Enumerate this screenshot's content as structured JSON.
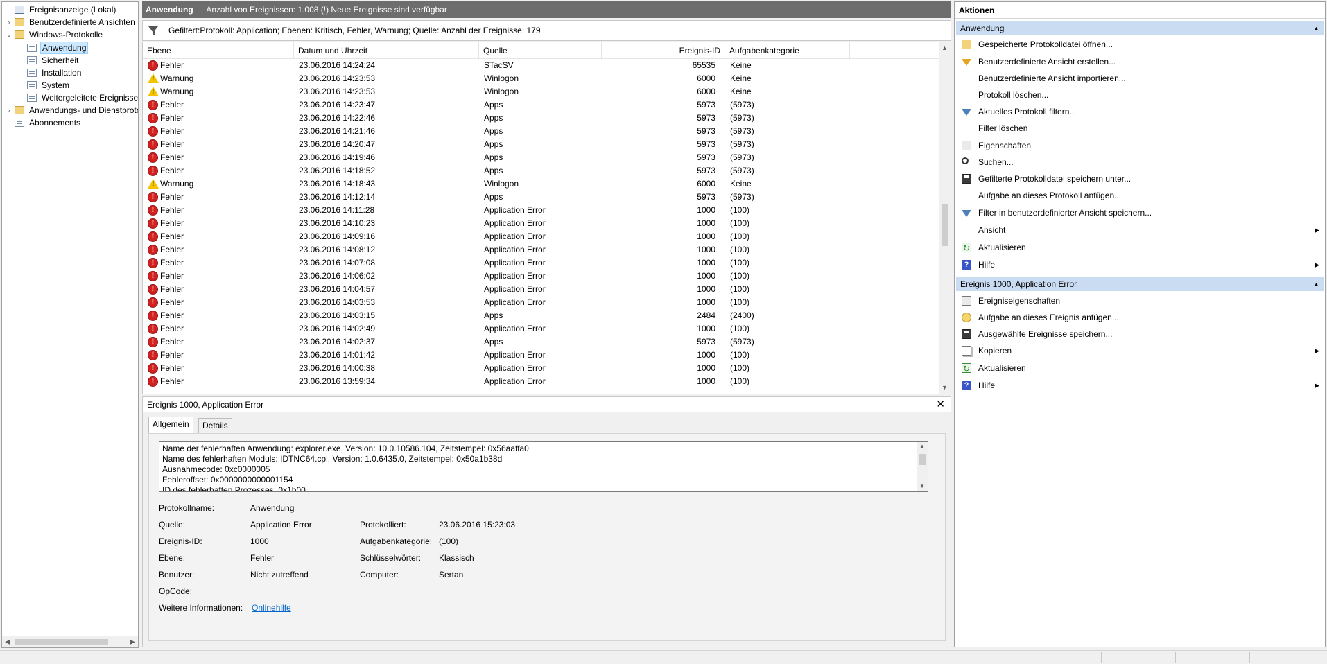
{
  "tree": {
    "items": [
      {
        "label": "Ereignisanzeige (Lokal)",
        "expander": "",
        "icon": "computer-icon"
      },
      {
        "label": "Benutzerdefinierte Ansichten",
        "expander": "›",
        "icon": "folder-icon"
      },
      {
        "label": "Windows-Protokolle",
        "expander": "⌄",
        "icon": "folder-icon"
      },
      {
        "label": "Anwendung",
        "expander": "",
        "icon": "log-icon"
      },
      {
        "label": "Sicherheit",
        "expander": "",
        "icon": "log-icon"
      },
      {
        "label": "Installation",
        "expander": "",
        "icon": "log-icon"
      },
      {
        "label": "System",
        "expander": "",
        "icon": "log-icon"
      },
      {
        "label": "Weitergeleitete Ereignisse",
        "expander": "",
        "icon": "log-icon"
      },
      {
        "label": "Anwendungs- und Dienstprotokolle",
        "expander": "›",
        "icon": "folder-icon"
      },
      {
        "label": "Abonnements",
        "expander": "",
        "icon": "subscription-icon"
      }
    ]
  },
  "header": {
    "title": "Anwendung",
    "info": "Anzahl von Ereignissen: 1.008 (!) Neue Ereignisse sind verfügbar"
  },
  "filter": {
    "text": "Gefiltert:Protokoll: Application; Ebenen: Kritisch, Fehler, Warnung; Quelle:  Anzahl der Ereignisse: 179"
  },
  "grid": {
    "columns": [
      "Ebene",
      "Datum und Uhrzeit",
      "Quelle",
      "Ereignis-ID",
      "Aufgabenkategorie"
    ],
    "rows": [
      {
        "level": "Fehler",
        "type": "error",
        "date": "23.06.2016 14:24:24",
        "source": "STacSV",
        "id": "65535",
        "cat": "Keine"
      },
      {
        "level": "Warnung",
        "type": "warning",
        "date": "23.06.2016 14:23:53",
        "source": "Winlogon",
        "id": "6000",
        "cat": "Keine"
      },
      {
        "level": "Warnung",
        "type": "warning",
        "date": "23.06.2016 14:23:53",
        "source": "Winlogon",
        "id": "6000",
        "cat": "Keine"
      },
      {
        "level": "Fehler",
        "type": "error",
        "date": "23.06.2016 14:23:47",
        "source": "Apps",
        "id": "5973",
        "cat": "(5973)"
      },
      {
        "level": "Fehler",
        "type": "error",
        "date": "23.06.2016 14:22:46",
        "source": "Apps",
        "id": "5973",
        "cat": "(5973)"
      },
      {
        "level": "Fehler",
        "type": "error",
        "date": "23.06.2016 14:21:46",
        "source": "Apps",
        "id": "5973",
        "cat": "(5973)"
      },
      {
        "level": "Fehler",
        "type": "error",
        "date": "23.06.2016 14:20:47",
        "source": "Apps",
        "id": "5973",
        "cat": "(5973)"
      },
      {
        "level": "Fehler",
        "type": "error",
        "date": "23.06.2016 14:19:46",
        "source": "Apps",
        "id": "5973",
        "cat": "(5973)"
      },
      {
        "level": "Fehler",
        "type": "error",
        "date": "23.06.2016 14:18:52",
        "source": "Apps",
        "id": "5973",
        "cat": "(5973)"
      },
      {
        "level": "Warnung",
        "type": "warning",
        "date": "23.06.2016 14:18:43",
        "source": "Winlogon",
        "id": "6000",
        "cat": "Keine"
      },
      {
        "level": "Fehler",
        "type": "error",
        "date": "23.06.2016 14:12:14",
        "source": "Apps",
        "id": "5973",
        "cat": "(5973)"
      },
      {
        "level": "Fehler",
        "type": "error",
        "date": "23.06.2016 14:11:28",
        "source": "Application Error",
        "id": "1000",
        "cat": "(100)"
      },
      {
        "level": "Fehler",
        "type": "error",
        "date": "23.06.2016 14:10:23",
        "source": "Application Error",
        "id": "1000",
        "cat": "(100)"
      },
      {
        "level": "Fehler",
        "type": "error",
        "date": "23.06.2016 14:09:16",
        "source": "Application Error",
        "id": "1000",
        "cat": "(100)"
      },
      {
        "level": "Fehler",
        "type": "error",
        "date": "23.06.2016 14:08:12",
        "source": "Application Error",
        "id": "1000",
        "cat": "(100)"
      },
      {
        "level": "Fehler",
        "type": "error",
        "date": "23.06.2016 14:07:08",
        "source": "Application Error",
        "id": "1000",
        "cat": "(100)"
      },
      {
        "level": "Fehler",
        "type": "error",
        "date": "23.06.2016 14:06:02",
        "source": "Application Error",
        "id": "1000",
        "cat": "(100)"
      },
      {
        "level": "Fehler",
        "type": "error",
        "date": "23.06.2016 14:04:57",
        "source": "Application Error",
        "id": "1000",
        "cat": "(100)"
      },
      {
        "level": "Fehler",
        "type": "error",
        "date": "23.06.2016 14:03:53",
        "source": "Application Error",
        "id": "1000",
        "cat": "(100)"
      },
      {
        "level": "Fehler",
        "type": "error",
        "date": "23.06.2016 14:03:15",
        "source": "Apps",
        "id": "2484",
        "cat": "(2400)"
      },
      {
        "level": "Fehler",
        "type": "error",
        "date": "23.06.2016 14:02:49",
        "source": "Application Error",
        "id": "1000",
        "cat": "(100)"
      },
      {
        "level": "Fehler",
        "type": "error",
        "date": "23.06.2016 14:02:37",
        "source": "Apps",
        "id": "5973",
        "cat": "(5973)"
      },
      {
        "level": "Fehler",
        "type": "error",
        "date": "23.06.2016 14:01:42",
        "source": "Application Error",
        "id": "1000",
        "cat": "(100)"
      },
      {
        "level": "Fehler",
        "type": "error",
        "date": "23.06.2016 14:00:38",
        "source": "Application Error",
        "id": "1000",
        "cat": "(100)"
      },
      {
        "level": "Fehler",
        "type": "error",
        "date": "23.06.2016 13:59:34",
        "source": "Application Error",
        "id": "1000",
        "cat": "(100)"
      }
    ]
  },
  "detail": {
    "title": "Ereignis 1000, Application Error",
    "tabs": [
      "Allgemein",
      "Details"
    ],
    "description": [
      "Name der fehlerhaften Anwendung: explorer.exe, Version: 10.0.10586.104, Zeitstempel: 0x56aaffa0",
      "Name des fehlerhaften Moduls: IDTNC64.cpl, Version: 1.0.6435.0, Zeitstempel: 0x50a1b38d",
      "Ausnahmecode: 0xc0000005",
      "Fehleroffset: 0x0000000000001154",
      "ID des fehlerhaften Prozesses: 0x1b00"
    ],
    "fields": {
      "protokollname_label": "Protokollname:",
      "protokollname": "Anwendung",
      "quelle_label": "Quelle:",
      "quelle": "Application Error",
      "protokolliert_label": "Protokolliert:",
      "protokolliert": "23.06.2016 15:23:03",
      "id_label": "Ereignis-ID:",
      "id": "1000",
      "kategorie_label": "Aufgabenkategorie:",
      "kategorie": "(100)",
      "ebene_label": "Ebene:",
      "ebene": "Fehler",
      "schluessel_label": "Schlüsselwörter:",
      "schluessel": "Klassisch",
      "benutzer_label": "Benutzer:",
      "benutzer": "Nicht zutreffend",
      "computer_label": "Computer:",
      "computer": "Sertan",
      "opcode_label": "OpCode:",
      "opcode": "",
      "info_label": "Weitere Informationen:",
      "info_link": "Onlinehilfe"
    }
  },
  "actions": {
    "title": "Aktionen",
    "section1": "Anwendung",
    "items1": [
      {
        "label": "Gespeicherte Protokolldatei öffnen...",
        "icon": "open-icon",
        "sub": ""
      },
      {
        "label": "Benutzerdefinierte Ansicht erstellen...",
        "icon": "filter-icon",
        "sub": ""
      },
      {
        "label": "Benutzerdefinierte Ansicht importieren...",
        "icon": "blank",
        "sub": ""
      },
      {
        "label": "Protokoll löschen...",
        "icon": "blank",
        "sub": ""
      },
      {
        "label": "Aktuelles Protokoll filtern...",
        "icon": "filter-blue-icon",
        "sub": ""
      },
      {
        "label": "Filter löschen",
        "icon": "blank",
        "sub": ""
      },
      {
        "label": "Eigenschaften",
        "icon": "properties-icon",
        "sub": ""
      },
      {
        "label": "Suchen...",
        "icon": "find-icon",
        "sub": ""
      },
      {
        "label": "Gefilterte Protokolldatei speichern unter...",
        "icon": "save-icon",
        "sub": ""
      },
      {
        "label": "Aufgabe an dieses Protokoll anfügen...",
        "icon": "blank",
        "sub": ""
      },
      {
        "label": "Filter in benutzerdefinierter Ansicht speichern...",
        "icon": "filter-save-icon",
        "sub": ""
      },
      {
        "label": "Ansicht",
        "icon": "blank",
        "sub": "▶"
      },
      {
        "label": "Aktualisieren",
        "icon": "refresh-icon",
        "sub": ""
      },
      {
        "label": "Hilfe",
        "icon": "help-icon",
        "sub": "▶"
      }
    ],
    "section2": "Ereignis 1000, Application Error",
    "items2": [
      {
        "label": "Ereigniseigenschaften",
        "icon": "properties-icon",
        "sub": ""
      },
      {
        "label": "Aufgabe an dieses Ereignis anfügen...",
        "icon": "task-icon",
        "sub": ""
      },
      {
        "label": "Ausgewählte Ereignisse speichern...",
        "icon": "save-icon",
        "sub": ""
      },
      {
        "label": "Kopieren",
        "icon": "copy-icon",
        "sub": "▶"
      },
      {
        "label": "Aktualisieren",
        "icon": "refresh-icon",
        "sub": ""
      },
      {
        "label": "Hilfe",
        "icon": "help-icon",
        "sub": "▶"
      }
    ]
  }
}
